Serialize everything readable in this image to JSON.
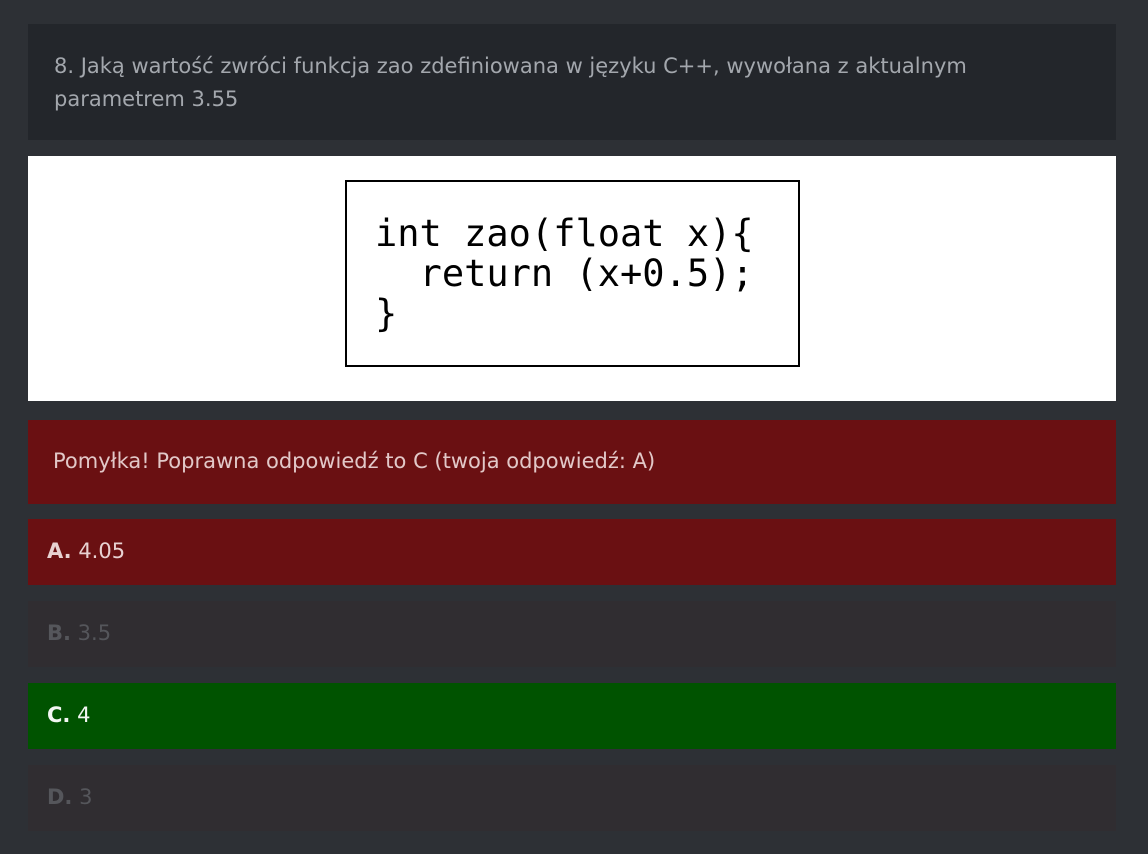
{
  "question": {
    "line1": "8. Jaką wartość zwróci funkcja zao zdefiniowana w języku C++, wywołana z aktualnym",
    "line2": "parametrem 3.55"
  },
  "code_image": {
    "lines": [
      "int zao(float x){",
      "  return (x+0.5);",
      "}"
    ]
  },
  "feedback": {
    "text": "Pomyłka! Poprawna odpowiedź to C (twoja odpowiedź: A)",
    "color": "#6a1012"
  },
  "answers": [
    {
      "letter": "A.",
      "value": "4.05",
      "state": "wrong-selected",
      "color": "#6a1012"
    },
    {
      "letter": "B.",
      "value": "3.5",
      "state": "dimmed",
      "color": "#302d31"
    },
    {
      "letter": "C.",
      "value": "4",
      "state": "correct",
      "color": "#005300"
    },
    {
      "letter": "D.",
      "value": "3",
      "state": "dimmed",
      "color": "#302d31"
    }
  ]
}
